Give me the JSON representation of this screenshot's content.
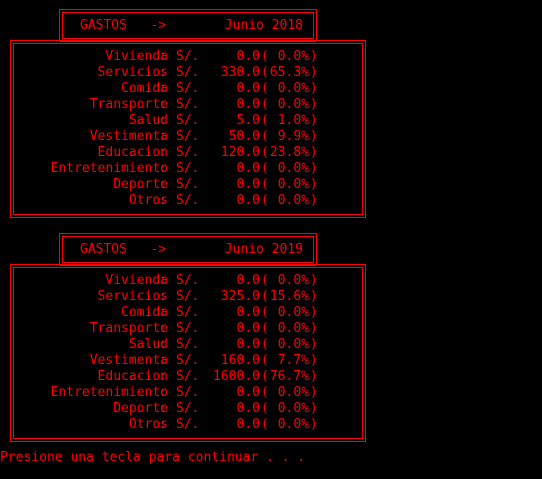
{
  "reports": [
    {
      "label": "GASTOS   ->",
      "period": "Junio 2018",
      "rows": [
        {
          "category": "Vivienda",
          "currency": "S/.",
          "amount": "0.0",
          "percent": "0.0%"
        },
        {
          "category": "Servicios",
          "currency": "S/.",
          "amount": "330.0",
          "percent": "65.3%"
        },
        {
          "category": "Comida",
          "currency": "S/.",
          "amount": "0.0",
          "percent": "0.0%"
        },
        {
          "category": "Transporte",
          "currency": "S/.",
          "amount": "0.0",
          "percent": "0.0%"
        },
        {
          "category": "Salud",
          "currency": "S/.",
          "amount": "5.0",
          "percent": "1.0%"
        },
        {
          "category": "Vestimenta",
          "currency": "S/.",
          "amount": "50.0",
          "percent": "9.9%"
        },
        {
          "category": "Educacion",
          "currency": "S/.",
          "amount": "120.0",
          "percent": "23.8%"
        },
        {
          "category": "Entretenimiento",
          "currency": "S/.",
          "amount": "0.0",
          "percent": "0.0%"
        },
        {
          "category": "Deporte",
          "currency": "S/.",
          "amount": "0.0",
          "percent": "0.0%"
        },
        {
          "category": "Otros",
          "currency": "S/.",
          "amount": "0.0",
          "percent": "0.0%"
        }
      ]
    },
    {
      "label": "GASTOS   ->",
      "period": "Junio 2019",
      "rows": [
        {
          "category": "Vivienda",
          "currency": "S/.",
          "amount": "0.0",
          "percent": "0.0%"
        },
        {
          "category": "Servicios",
          "currency": "S/.",
          "amount": "325.0",
          "percent": "15.6%"
        },
        {
          "category": "Comida",
          "currency": "S/.",
          "amount": "0.0",
          "percent": "0.0%"
        },
        {
          "category": "Transporte",
          "currency": "S/.",
          "amount": "0.0",
          "percent": "0.0%"
        },
        {
          "category": "Salud",
          "currency": "S/.",
          "amount": "0.0",
          "percent": "0.0%"
        },
        {
          "category": "Vestimenta",
          "currency": "S/.",
          "amount": "160.0",
          "percent": "7.7%"
        },
        {
          "category": "Educacion",
          "currency": "S/.",
          "amount": "1600.0",
          "percent": "76.7%"
        },
        {
          "category": "Entretenimiento",
          "currency": "S/.",
          "amount": "0.0",
          "percent": "0.0%"
        },
        {
          "category": "Deporte",
          "currency": "S/.",
          "amount": "0.0",
          "percent": "0.0%"
        },
        {
          "category": "Otros",
          "currency": "S/.",
          "amount": "0.0",
          "percent": "0.0%"
        }
      ]
    }
  ],
  "prompt": "Presione una tecla para continuar . . .",
  "colors": {
    "background": "#000000",
    "foreground": "#ff0000"
  }
}
